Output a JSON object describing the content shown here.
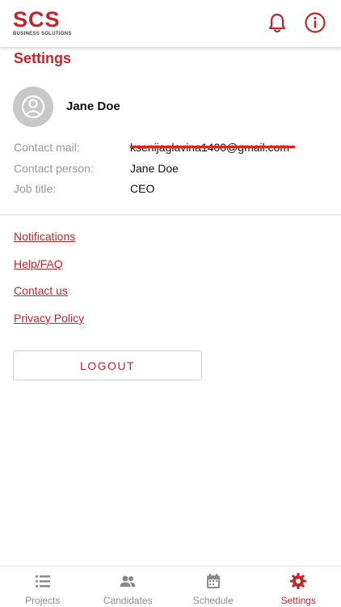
{
  "header": {
    "logo_text": "SCS",
    "logo_subtext": "BUSINESS SOLUTIONS",
    "bell_icon": "bell-icon",
    "info_icon": "info-icon"
  },
  "page": {
    "title": "Settings"
  },
  "profile": {
    "name": "Jane Doe",
    "avatar_icon": "user-avatar-icon"
  },
  "details": {
    "contact_mail_label": "Contact mail:",
    "contact_mail_value": "ksenijaglavina1400@gmail.com",
    "contact_person_label": "Contact person:",
    "contact_person_value": "Jane Doe",
    "job_title_label": "Job title:",
    "job_title_value": "CEO"
  },
  "links": {
    "notifications": "Notifications",
    "help": "Help/FAQ",
    "contact": "Contact us",
    "privacy": "Privacy Policy"
  },
  "logout_label": "LOGOUT",
  "tabs": {
    "projects": "Projects",
    "candidates": "Candidates",
    "schedule": "Schedule",
    "settings": "Settings"
  },
  "colors": {
    "accent": "#c0272d",
    "muted": "#8a8a8a",
    "strike": "#e0241a"
  }
}
